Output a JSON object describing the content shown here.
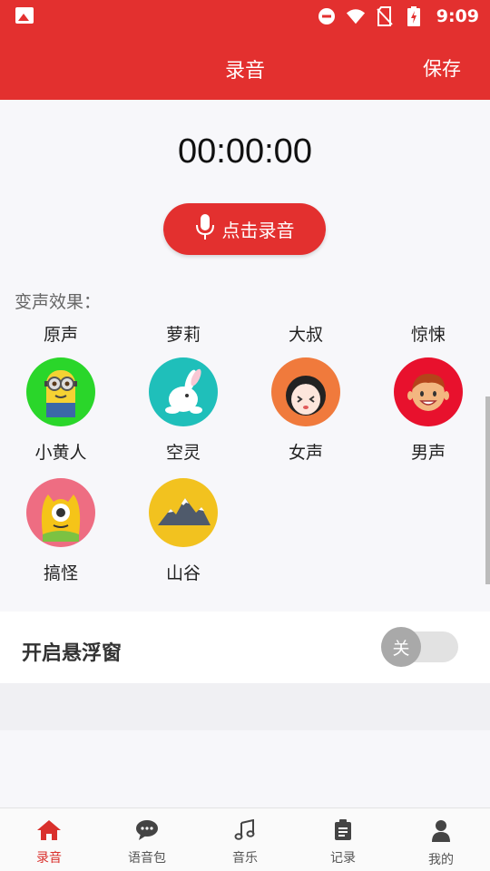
{
  "status_bar": {
    "time": "9:09",
    "icons": [
      "gallery-icon",
      "dnd-icon",
      "wifi-icon",
      "no-sim-icon",
      "battery-icon"
    ]
  },
  "header": {
    "title": "录音",
    "save_label": "保存"
  },
  "timer": "00:00:00",
  "record_button": {
    "label": "点击录音",
    "icon": "microphone-icon"
  },
  "effects_section": {
    "label": "变声效果：",
    "text_items": [
      "原声",
      "萝莉",
      "大叔",
      "惊悚"
    ],
    "icon_items": [
      {
        "label": "小黄人",
        "icon": "minion-icon",
        "color": "#2ad62a"
      },
      {
        "label": "空灵",
        "icon": "rabbit-icon",
        "color": "#1fbfba"
      },
      {
        "label": "女声",
        "icon": "girl-face-icon",
        "color": "#f07a3c"
      },
      {
        "label": "男声",
        "icon": "boy-face-icon",
        "color": "#e8112d"
      },
      {
        "label": "搞怪",
        "icon": "one-eyed-monster-icon",
        "color": "#ee6d82"
      },
      {
        "label": "山谷",
        "icon": "mountain-icon",
        "color": "#f2c21f"
      }
    ]
  },
  "floating_window": {
    "label": "开启悬浮窗",
    "toggle_text": "关",
    "enabled": false
  },
  "bottom_nav": [
    {
      "label": "录音",
      "icon": "home-icon",
      "active": true
    },
    {
      "label": "语音包",
      "icon": "chat-bubble-icon",
      "active": false
    },
    {
      "label": "音乐",
      "icon": "music-note-icon",
      "active": false
    },
    {
      "label": "记录",
      "icon": "clipboard-icon",
      "active": false
    },
    {
      "label": "我的",
      "icon": "person-icon",
      "active": false
    }
  ],
  "colors": {
    "brand_red": "#e3302f",
    "nav_active": "#d9302c",
    "page_bg": "#f7f7fa"
  }
}
